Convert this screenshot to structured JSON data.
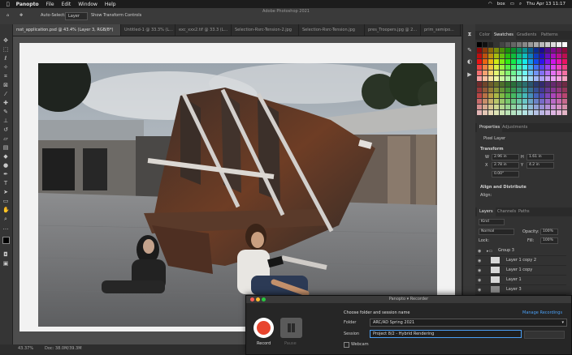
{
  "menubar": {
    "app": "Panopto",
    "items": [
      "File",
      "Edit",
      "Window",
      "Help"
    ],
    "status_items": [
      "box"
    ],
    "datetime": "Thu Apr 13  11:17"
  },
  "window": {
    "title": "Adobe Photoshop 2021"
  },
  "options": {
    "auto_select_label": "Auto-Select:",
    "auto_select_value": "Layer",
    "transform_label": "Show Transform Controls"
  },
  "tabs": [
    {
      "label": "rsst_application.psd @ 43.4% (Layer 3, RGB/8*)",
      "active": true
    },
    {
      "label": "Untitled-1 @ 33.3% (L..."
    },
    {
      "label": "exc_xxx2.tif @ 33.3 (L..."
    },
    {
      "label": "Selection-Rsrc-Tension-2.jpg"
    },
    {
      "label": "Selection-Rsrc-Tension.jpg"
    },
    {
      "label": "pres_Troopers.jpg @ 2..."
    },
    {
      "label": "prim_semipo..."
    }
  ],
  "status": {
    "zoom": "43.37%",
    "doc": "Doc: 38.0M/39.3M"
  },
  "panels": {
    "top_tabs": [
      "Color",
      "Swatches",
      "Gradients",
      "Patterns"
    ],
    "properties_tabs": [
      "Properties",
      "Adjustments"
    ],
    "properties_layer": "Pixel Layer",
    "transform_label": "Transform",
    "transform": {
      "w": "2.96 in",
      "h": "1.61 in",
      "x": "2.78 in",
      "y": "4.2 in",
      "angle": "0.00°"
    },
    "align_label": "Align and Distribute",
    "align_sub": "Align:",
    "layers_tabs": [
      "Layers",
      "Channels",
      "Paths"
    ],
    "kind_label": "Kind",
    "blend_mode": "Normal",
    "opacity_label": "Opacity:",
    "opacity_value": "100%",
    "lock_label": "Lock:",
    "fill_label": "Fill:",
    "fill_value": "100%",
    "layers": [
      {
        "name": "Group 3",
        "type": "group"
      },
      {
        "name": "Layer 1 copy 2",
        "type": "layer"
      },
      {
        "name": "Layer 1 copy",
        "type": "layer"
      },
      {
        "name": "Layer 1",
        "type": "layer"
      },
      {
        "name": "Layer 3",
        "type": "layer"
      }
    ]
  },
  "recorder": {
    "title": "Panopto ▾ Recorder",
    "heading": "Choose folder and session name",
    "manage_link": "Manage Recordings",
    "folder_label": "Folder",
    "folder_value": "ARC/AD Spring 2021",
    "session_label": "Session",
    "session_value": "Project 8/2 - Hybrid Rendering",
    "webcam_label": "Webcam",
    "record_label": "Record",
    "pause_label": "Pause",
    "accent_color": "#e8452e"
  },
  "colors": {
    "ui_bg": "#323232",
    "link": "#4a9ff5"
  }
}
